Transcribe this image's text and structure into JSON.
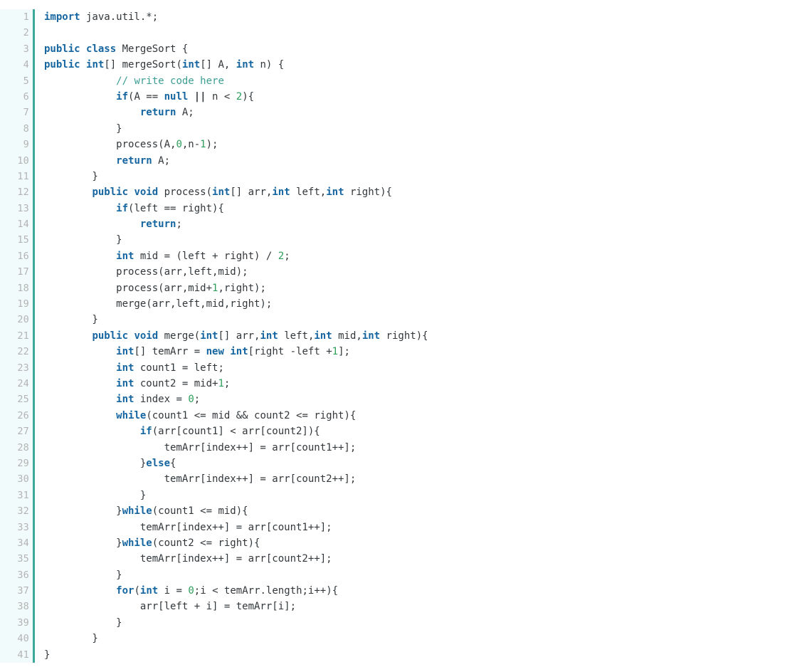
{
  "editor": {
    "language": "java",
    "background_color": "#ffffff",
    "gutter_background_color": "#f2fbfb",
    "gutter_border_color": "#3aa99a",
    "line_number_color": "#b3b3b3",
    "total_lines": 41,
    "colors": {
      "keyword": "#1565a0",
      "comment": "#3c9e93",
      "number": "#2e9e5b",
      "plain": "#32373b"
    }
  },
  "line_numbers": [
    "1",
    "2",
    "3",
    "4",
    "5",
    "6",
    "7",
    "8",
    "9",
    "10",
    "11",
    "12",
    "13",
    "14",
    "15",
    "16",
    "17",
    "18",
    "19",
    "20",
    "21",
    "22",
    "23",
    "24",
    "25",
    "26",
    "27",
    "28",
    "29",
    "30",
    "31",
    "32",
    "33",
    "34",
    "35",
    "36",
    "37",
    "38",
    "39",
    "40",
    "41"
  ],
  "code_lines": [
    "import java.util.*;",
    "",
    "public class MergeSort {",
    "public int[] mergeSort(int[] A, int n) {",
    "            // write code here",
    "            if(A == null || n < 2){",
    "                return A;",
    "            }",
    "            process(A,0,n-1);",
    "            return A;",
    "        }",
    "        public void process(int[] arr,int left,int right){",
    "            if(left == right){",
    "                return;",
    "            }",
    "            int mid = (left + right) / 2;",
    "            process(arr,left,mid);",
    "            process(arr,mid+1,right);",
    "            merge(arr,left,mid,right);",
    "        }",
    "        public void merge(int[] arr,int left,int mid,int right){",
    "            int[] temArr = new int[right -left +1];",
    "            int count1 = left;",
    "            int count2 = mid+1;",
    "            int index = 0;",
    "            while(count1 <= mid && count2 <= right){",
    "                if(arr[count1] < arr[count2]){",
    "                    temArr[index++] = arr[count1++];",
    "                }else{",
    "                    temArr[index++] = arr[count2++];",
    "                }",
    "            }while(count1 <= mid){",
    "                temArr[index++] = arr[count1++];",
    "            }while(count2 <= right){",
    "                temArr[index++] = arr[count2++];",
    "            }",
    "            for(int i = 0;i < temArr.length;i++){",
    "                arr[left + i] = temArr[i];",
    "            }",
    "        }",
    "}"
  ],
  "tokens": [
    [
      [
        "kw",
        "import"
      ],
      [
        "pl",
        " java.util.*;"
      ]
    ],
    [],
    [
      [
        "kw",
        "public"
      ],
      [
        "pl",
        " "
      ],
      [
        "kw",
        "class"
      ],
      [
        "pl",
        " MergeSort {"
      ]
    ],
    [
      [
        "kw",
        "public"
      ],
      [
        "pl",
        " "
      ],
      [
        "kw",
        "int"
      ],
      [
        "pl",
        "[] mergeSort("
      ],
      [
        "kw",
        "int"
      ],
      [
        "pl",
        "[] A, "
      ],
      [
        "kw",
        "int"
      ],
      [
        "pl",
        " n) {"
      ]
    ],
    [
      [
        "pl",
        "            "
      ],
      [
        "cmt",
        "// write code here"
      ]
    ],
    [
      [
        "pl",
        "            "
      ],
      [
        "kw",
        "if"
      ],
      [
        "pl",
        "(A == "
      ],
      [
        "kw",
        "null"
      ],
      [
        "pl",
        " "
      ],
      [
        "op",
        "||"
      ],
      [
        "pl",
        " n < "
      ],
      [
        "num",
        "2"
      ],
      [
        "pl",
        "){"
      ]
    ],
    [
      [
        "pl",
        "                "
      ],
      [
        "kw",
        "return"
      ],
      [
        "pl",
        " A;"
      ]
    ],
    [
      [
        "pl",
        "            }"
      ]
    ],
    [
      [
        "pl",
        "            process(A,"
      ],
      [
        "num",
        "0"
      ],
      [
        "pl",
        ",n-"
      ],
      [
        "num",
        "1"
      ],
      [
        "pl",
        ");"
      ]
    ],
    [
      [
        "pl",
        "            "
      ],
      [
        "kw",
        "return"
      ],
      [
        "pl",
        " A;"
      ]
    ],
    [
      [
        "pl",
        "        }"
      ]
    ],
    [
      [
        "pl",
        "        "
      ],
      [
        "kw",
        "public"
      ],
      [
        "pl",
        " "
      ],
      [
        "kw",
        "void"
      ],
      [
        "pl",
        " process("
      ],
      [
        "kw",
        "int"
      ],
      [
        "pl",
        "[] arr,"
      ],
      [
        "kw",
        "int"
      ],
      [
        "pl",
        " left,"
      ],
      [
        "kw",
        "int"
      ],
      [
        "pl",
        " right){"
      ]
    ],
    [
      [
        "pl",
        "            "
      ],
      [
        "kw",
        "if"
      ],
      [
        "pl",
        "(left == right){"
      ]
    ],
    [
      [
        "pl",
        "                "
      ],
      [
        "kw",
        "return"
      ],
      [
        "pl",
        ";"
      ]
    ],
    [
      [
        "pl",
        "            }"
      ]
    ],
    [
      [
        "pl",
        "            "
      ],
      [
        "kw",
        "int"
      ],
      [
        "pl",
        " mid = (left + right) / "
      ],
      [
        "num",
        "2"
      ],
      [
        "pl",
        ";"
      ]
    ],
    [
      [
        "pl",
        "            process(arr,left,mid);"
      ]
    ],
    [
      [
        "pl",
        "            process(arr,mid+"
      ],
      [
        "num",
        "1"
      ],
      [
        "pl",
        ",right);"
      ]
    ],
    [
      [
        "pl",
        "            merge(arr,left,mid,right);"
      ]
    ],
    [
      [
        "pl",
        "        }"
      ]
    ],
    [
      [
        "pl",
        "        "
      ],
      [
        "kw",
        "public"
      ],
      [
        "pl",
        " "
      ],
      [
        "kw",
        "void"
      ],
      [
        "pl",
        " merge("
      ],
      [
        "kw",
        "int"
      ],
      [
        "pl",
        "[] arr,"
      ],
      [
        "kw",
        "int"
      ],
      [
        "pl",
        " left,"
      ],
      [
        "kw",
        "int"
      ],
      [
        "pl",
        " mid,"
      ],
      [
        "kw",
        "int"
      ],
      [
        "pl",
        " right){"
      ]
    ],
    [
      [
        "pl",
        "            "
      ],
      [
        "kw",
        "int"
      ],
      [
        "pl",
        "[] temArr = "
      ],
      [
        "kw",
        "new"
      ],
      [
        "pl",
        " "
      ],
      [
        "kw",
        "int"
      ],
      [
        "pl",
        "[right -left +"
      ],
      [
        "num",
        "1"
      ],
      [
        "pl",
        "];"
      ]
    ],
    [
      [
        "pl",
        "            "
      ],
      [
        "kw",
        "int"
      ],
      [
        "pl",
        " count1 = left;"
      ]
    ],
    [
      [
        "pl",
        "            "
      ],
      [
        "kw",
        "int"
      ],
      [
        "pl",
        " count2 = mid+"
      ],
      [
        "num",
        "1"
      ],
      [
        "pl",
        ";"
      ]
    ],
    [
      [
        "pl",
        "            "
      ],
      [
        "kw",
        "int"
      ],
      [
        "pl",
        " index = "
      ],
      [
        "num",
        "0"
      ],
      [
        "pl",
        ";"
      ]
    ],
    [
      [
        "pl",
        "            "
      ],
      [
        "kw",
        "while"
      ],
      [
        "pl",
        "(count1 <= mid && count2 <= right){"
      ]
    ],
    [
      [
        "pl",
        "                "
      ],
      [
        "kw",
        "if"
      ],
      [
        "pl",
        "(arr[count1] < arr[count2]){"
      ]
    ],
    [
      [
        "pl",
        "                    temArr[index++] = arr[count1++];"
      ]
    ],
    [
      [
        "pl",
        "                }"
      ],
      [
        "kw",
        "else"
      ],
      [
        "pl",
        "{"
      ]
    ],
    [
      [
        "pl",
        "                    temArr[index++] = arr[count2++];"
      ]
    ],
    [
      [
        "pl",
        "                }"
      ]
    ],
    [
      [
        "pl",
        "            }"
      ],
      [
        "kw",
        "while"
      ],
      [
        "pl",
        "(count1 <= mid){"
      ]
    ],
    [
      [
        "pl",
        "                temArr[index++] = arr[count1++];"
      ]
    ],
    [
      [
        "pl",
        "            }"
      ],
      [
        "kw",
        "while"
      ],
      [
        "pl",
        "(count2 <= right){"
      ]
    ],
    [
      [
        "pl",
        "                temArr[index++] = arr[count2++];"
      ]
    ],
    [
      [
        "pl",
        "            }"
      ]
    ],
    [
      [
        "pl",
        "            "
      ],
      [
        "kw",
        "for"
      ],
      [
        "pl",
        "("
      ],
      [
        "kw",
        "int"
      ],
      [
        "pl",
        " i = "
      ],
      [
        "num",
        "0"
      ],
      [
        "pl",
        ";i < temArr.length;i++){"
      ]
    ],
    [
      [
        "pl",
        "                arr[left + i] = temArr[i];"
      ]
    ],
    [
      [
        "pl",
        "            }"
      ]
    ],
    [
      [
        "pl",
        "        }"
      ]
    ],
    [
      [
        "pl",
        "}"
      ]
    ]
  ]
}
